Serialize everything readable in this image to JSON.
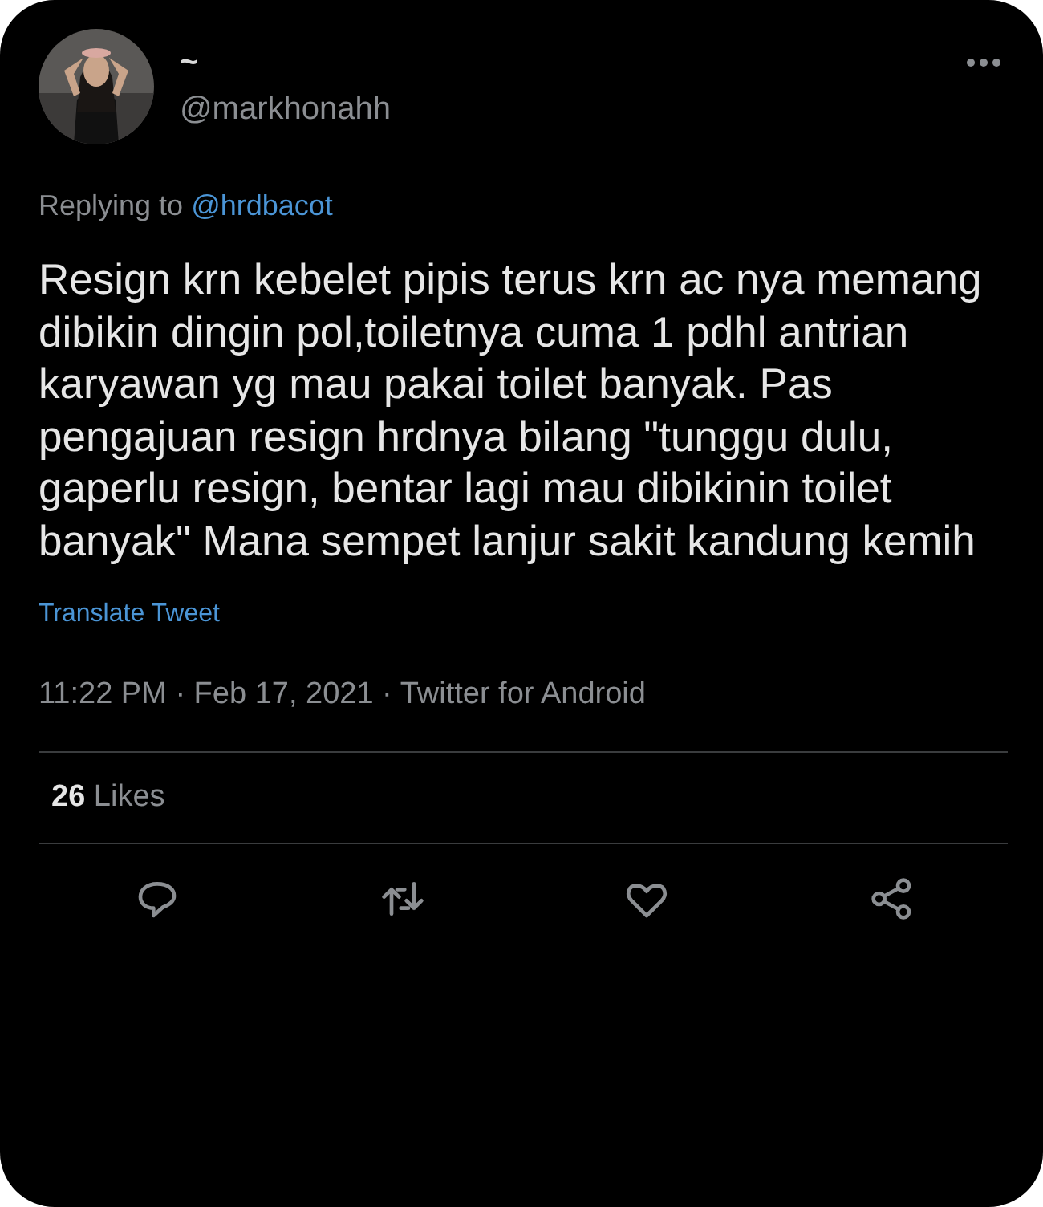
{
  "author": {
    "name": "~",
    "handle": "@markhonahh"
  },
  "reply": {
    "label": "Replying to",
    "mention": "@hrdbacot"
  },
  "text": "Resign krn kebelet pipis terus krn ac nya memang dibikin dingin pol,toiletnya cuma 1 pdhl antrian karyawan yg mau pakai toilet banyak. Pas pengajuan resign hrdnya bilang \"tunggu dulu, gaperlu resign, bentar lagi mau dibikinin toilet banyak\" Mana sempet lanjur sakit kandung kemih",
  "translate": "Translate Tweet",
  "timestamp": "11:22 PM · Feb 17, 2021 · Twitter for Android",
  "likes": "**26** Likes",
  "actions": [
    {
      "kind": "reply"
    },
    {
      "kind": "retweet"
    },
    {
      "kind": "like"
    },
    {
      "kind": "share"
    }
  ]
}
